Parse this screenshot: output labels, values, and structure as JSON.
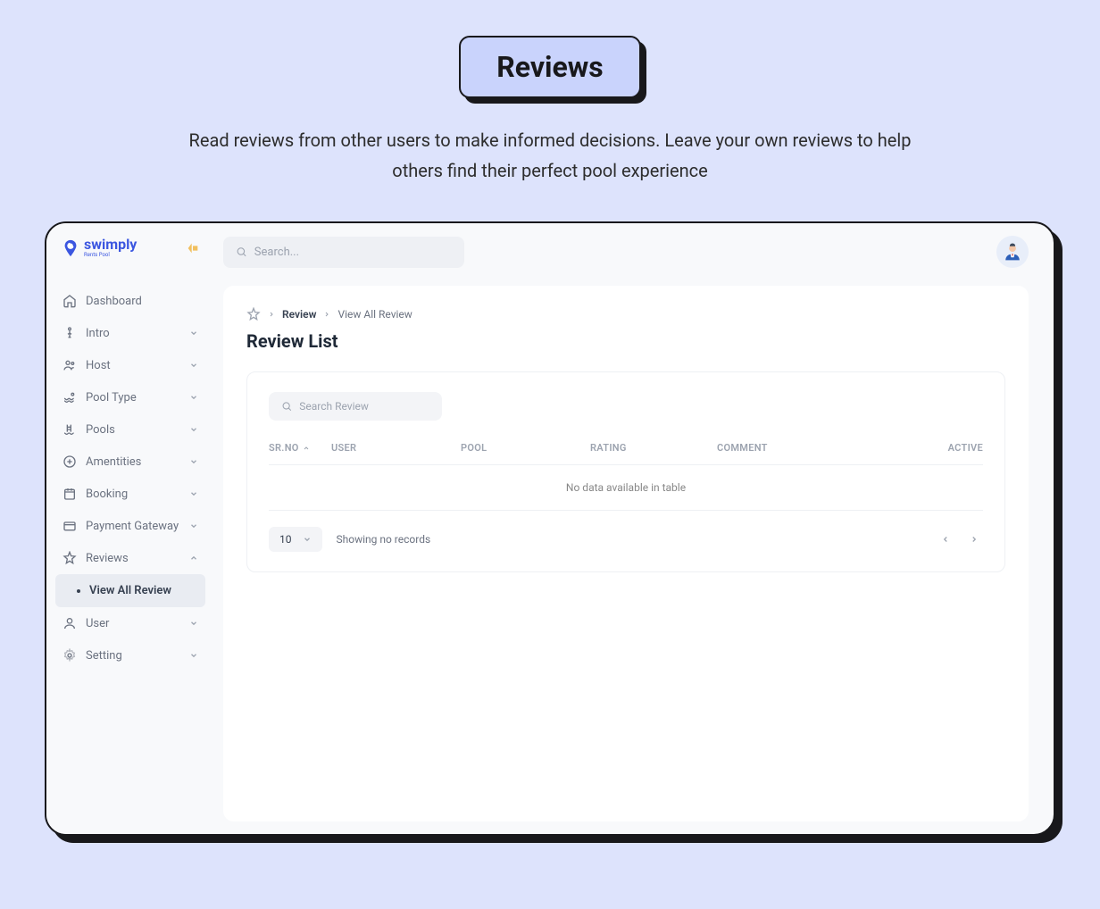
{
  "header": {
    "badge": "Reviews",
    "description": "Read reviews from other users to make informed decisions. Leave your own reviews to help others find their perfect pool experience"
  },
  "logo": {
    "name": "swimply",
    "tagline": "Rents Pool"
  },
  "topbar": {
    "search_placeholder": "Search..."
  },
  "sidebar": {
    "items": [
      {
        "label": "Dashboard",
        "expandable": false
      },
      {
        "label": "Intro",
        "expandable": true
      },
      {
        "label": "Host",
        "expandable": true
      },
      {
        "label": "Pool Type",
        "expandable": true
      },
      {
        "label": "Pools",
        "expandable": true
      },
      {
        "label": "Amentities",
        "expandable": true
      },
      {
        "label": "Booking",
        "expandable": true
      },
      {
        "label": "Payment Gateway",
        "expandable": true
      },
      {
        "label": "Reviews",
        "expandable": true,
        "expanded": true,
        "children": [
          {
            "label": "View All Review",
            "active": true
          }
        ]
      },
      {
        "label": "User",
        "expandable": true
      },
      {
        "label": "Setting",
        "expandable": true
      }
    ]
  },
  "breadcrumb": {
    "items": [
      "Review",
      "View All Review"
    ]
  },
  "page": {
    "title": "Review List",
    "search_placeholder": "Search Review",
    "columns": [
      "SR.NO",
      "USER",
      "POOL",
      "RATING",
      "COMMENT",
      "ACTIVE"
    ],
    "empty_message": "No data available in table",
    "page_size": "10",
    "footer_text": "Showing no records"
  }
}
